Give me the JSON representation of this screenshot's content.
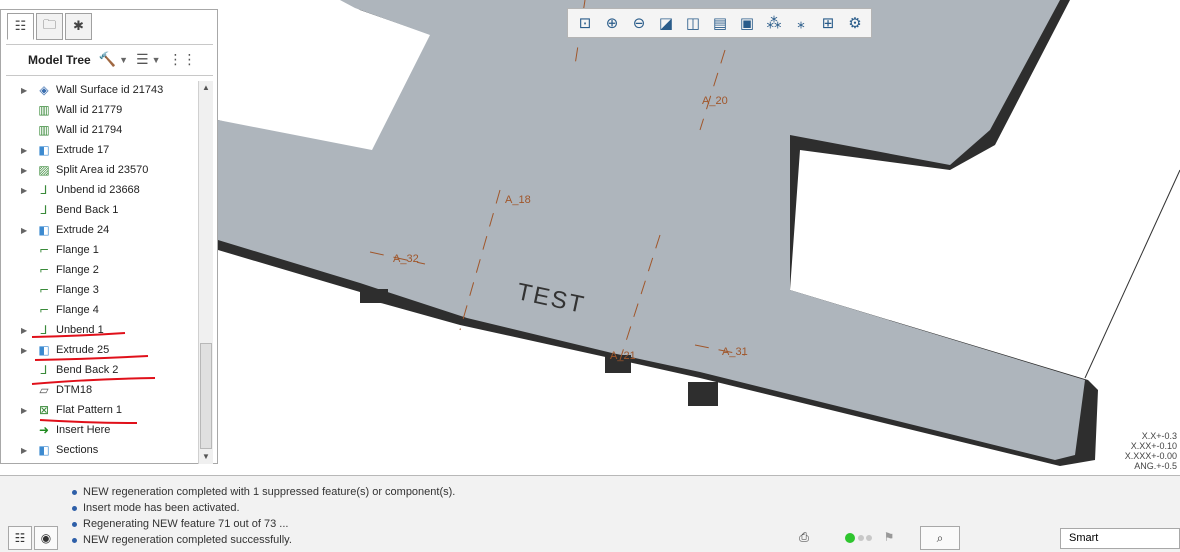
{
  "model_tree": {
    "title": "Model Tree",
    "items": [
      {
        "label": "Wall Surface id 21743",
        "expandable": true,
        "icon": "surface-icon"
      },
      {
        "label": "Wall id 21779",
        "expandable": false,
        "icon": "wall-icon"
      },
      {
        "label": "Wall id 21794",
        "expandable": false,
        "icon": "wall-icon"
      },
      {
        "label": "Extrude 17",
        "expandable": true,
        "icon": "extrude-icon"
      },
      {
        "label": "Split Area id 23570",
        "expandable": true,
        "icon": "split-area-icon"
      },
      {
        "label": "Unbend id 23668",
        "expandable": true,
        "icon": "unbend-icon"
      },
      {
        "label": "Bend Back 1",
        "expandable": false,
        "icon": "bend-back-icon"
      },
      {
        "label": "Extrude 24",
        "expandable": true,
        "icon": "extrude-icon"
      },
      {
        "label": "Flange 1",
        "expandable": false,
        "icon": "flange-icon"
      },
      {
        "label": "Flange 2",
        "expandable": false,
        "icon": "flange-icon"
      },
      {
        "label": "Flange 3",
        "expandable": false,
        "icon": "flange-icon"
      },
      {
        "label": "Flange 4",
        "expandable": false,
        "icon": "flange-icon"
      },
      {
        "label": "Unbend 1",
        "expandable": true,
        "icon": "unbend-icon"
      },
      {
        "label": "Extrude 25",
        "expandable": true,
        "icon": "extrude-icon"
      },
      {
        "label": "Bend Back 2",
        "expandable": false,
        "icon": "bend-back-icon"
      },
      {
        "label": "DTM18",
        "expandable": false,
        "icon": "datum-plane-icon"
      },
      {
        "label": "Flat Pattern 1",
        "expandable": true,
        "icon": "flat-pattern-icon"
      },
      {
        "label": "Insert Here",
        "expandable": false,
        "icon": "insert-arrow-icon"
      },
      {
        "label": "Sections",
        "expandable": true,
        "icon": "sections-icon"
      }
    ]
  },
  "viewport": {
    "engraved_text": "TEST",
    "axes": [
      "A_20",
      "A_18",
      "A_32",
      "A_21",
      "A_31"
    ],
    "tolerances": [
      "X.X+-0.3",
      "X.XX+-0.10",
      "X.XXX+-0.00",
      "ANG.+-0.5"
    ],
    "part_color": "#aeb5bc",
    "edge_color": "#2e2e2e",
    "axis_color": "#a0562a",
    "markup_color": "#e0101a"
  },
  "view_toolbar": {
    "tools": [
      "zoom-fit-icon",
      "zoom-in-icon",
      "zoom-out-icon",
      "repaint-icon",
      "display-style-icon",
      "saved-views-icon",
      "view-manager-icon",
      "datum-planes-toggle-icon",
      "datum-axes-toggle-icon",
      "point-toggle-icon",
      "coordinate-system-toggle-icon"
    ]
  },
  "status": {
    "messages": [
      "NEW regeneration completed with 1 suppressed feature(s) or component(s).",
      "Insert mode has been activated.",
      "Regenerating NEW feature 71 out of 73 ...",
      "NEW regeneration completed successfully."
    ],
    "filter": "Smart"
  }
}
